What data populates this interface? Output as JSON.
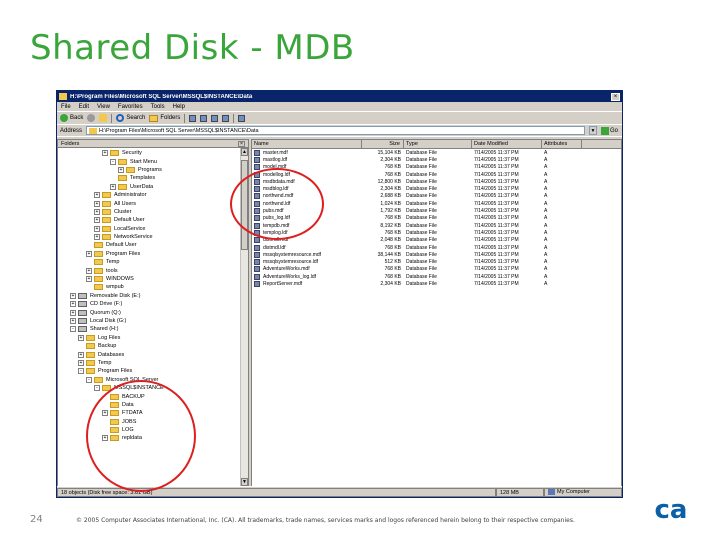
{
  "slide": {
    "title": "Shared Disk - MDB",
    "page_number": "24",
    "copyright": "© 2005 Computer Associates International, Inc. (CA). All trademarks, trade names, services marks and logos referenced herein belong to their respective companies.",
    "logo_text": "ca"
  },
  "window": {
    "title": "H:\\Program Files\\Microsoft SQL Server\\MSSQL$INSTANCE\\Data",
    "close_glyph": "×",
    "menu": [
      "File",
      "Edit",
      "View",
      "Favorites",
      "Tools",
      "Help"
    ],
    "toolbar": {
      "back": "Back",
      "search": "Search",
      "folders": "Folders"
    },
    "address_label": "Address",
    "address_value": "H:\\Program Files\\Microsoft SQL Server\\MSSQL$INSTANCE\\Data",
    "go_label": "Go",
    "dropdown_glyph": "▼"
  },
  "tree": {
    "header": "Folders",
    "close_glyph": "×",
    "nodes": [
      {
        "label": "Security",
        "type": "folder",
        "exp": "+"
      },
      {
        "label": "Start Menu",
        "type": "folder",
        "exp": "-"
      },
      {
        "label": "Programs",
        "type": "folder",
        "exp": "+"
      },
      {
        "label": "Templates",
        "type": "folder",
        "exp": ""
      },
      {
        "label": "UserData",
        "type": "folder",
        "exp": "+"
      },
      {
        "label": "Administrator",
        "type": "folder",
        "exp": "+"
      },
      {
        "label": "All Users",
        "type": "folder",
        "exp": "+"
      },
      {
        "label": "Cluster",
        "type": "folder",
        "exp": "+"
      },
      {
        "label": "Default User",
        "type": "folder",
        "exp": "+"
      },
      {
        "label": "LocalService",
        "type": "folder",
        "exp": "+"
      },
      {
        "label": "NetworkService",
        "type": "folder",
        "exp": "+"
      },
      {
        "label": "Default User",
        "type": "folder",
        "exp": ""
      },
      {
        "label": "Program Files",
        "type": "folder",
        "exp": "+"
      },
      {
        "label": "Temp",
        "type": "folder",
        "exp": ""
      },
      {
        "label": "tools",
        "type": "folder",
        "exp": "+"
      },
      {
        "label": "WINDOWS",
        "type": "folder",
        "exp": "+"
      },
      {
        "label": "wmpub",
        "type": "folder",
        "exp": ""
      },
      {
        "label": "Removable Disk (E:)",
        "type": "drive",
        "exp": "+"
      },
      {
        "label": "CD Drive (F:)",
        "type": "drive",
        "exp": "+"
      },
      {
        "label": "Quorum (Q:)",
        "type": "drive",
        "exp": "+"
      },
      {
        "label": "Local Disk (G:)",
        "type": "drive",
        "exp": "+"
      },
      {
        "label": "Shared (H:)",
        "type": "drive",
        "exp": "-"
      },
      {
        "label": "Log Files",
        "type": "folder",
        "exp": "+"
      },
      {
        "label": "Backup",
        "type": "folder",
        "exp": ""
      },
      {
        "label": "Databases",
        "type": "folder",
        "exp": "+"
      },
      {
        "label": "Temp",
        "type": "folder",
        "exp": "+"
      },
      {
        "label": "Program Files",
        "type": "folder",
        "exp": "-"
      },
      {
        "label": "Microsoft SQL Server",
        "type": "folder",
        "exp": "-"
      },
      {
        "label": "MSSQL$INSTANCE",
        "type": "folder",
        "exp": "-"
      },
      {
        "label": "BACKUP",
        "type": "folder",
        "exp": ""
      },
      {
        "label": "Data",
        "type": "folder",
        "exp": ""
      },
      {
        "label": "FTDATA",
        "type": "folder",
        "exp": "+"
      },
      {
        "label": "JOBS",
        "type": "folder",
        "exp": ""
      },
      {
        "label": "LOG",
        "type": "folder",
        "exp": ""
      },
      {
        "label": "repldata",
        "type": "folder",
        "exp": "+"
      }
    ]
  },
  "list": {
    "headers": [
      "Name",
      "Size",
      "Type",
      "Date Modified",
      "Attributes"
    ],
    "rows": [
      {
        "name": "master.mdf",
        "size": "15,104 KB",
        "type": "Database File",
        "date": "7/14/2005 11:37 PM",
        "attr": "A"
      },
      {
        "name": "mastlog.ldf",
        "size": "2,304 KB",
        "type": "Database File",
        "date": "7/14/2005 11:37 PM",
        "attr": "A"
      },
      {
        "name": "model.mdf",
        "size": "768 KB",
        "type": "Database File",
        "date": "7/14/2005 11:37 PM",
        "attr": "A"
      },
      {
        "name": "modellog.ldf",
        "size": "768 KB",
        "type": "Database File",
        "date": "7/14/2005 11:37 PM",
        "attr": "A"
      },
      {
        "name": "msdbdata.mdf",
        "size": "12,800 KB",
        "type": "Database File",
        "date": "7/14/2005 11:37 PM",
        "attr": "A"
      },
      {
        "name": "msdblog.ldf",
        "size": "2,304 KB",
        "type": "Database File",
        "date": "7/14/2005 11:37 PM",
        "attr": "A"
      },
      {
        "name": "northwnd.mdf",
        "size": "2,688 KB",
        "type": "Database File",
        "date": "7/14/2005 11:37 PM",
        "attr": "A"
      },
      {
        "name": "northwnd.ldf",
        "size": "1,024 KB",
        "type": "Database File",
        "date": "7/14/2005 11:37 PM",
        "attr": "A"
      },
      {
        "name": "pubs.mdf",
        "size": "1,792 KB",
        "type": "Database File",
        "date": "7/14/2005 11:37 PM",
        "attr": "A"
      },
      {
        "name": "pubs_log.ldf",
        "size": "768 KB",
        "type": "Database File",
        "date": "7/14/2005 11:37 PM",
        "attr": "A"
      },
      {
        "name": "tempdb.mdf",
        "size": "8,192 KB",
        "type": "Database File",
        "date": "7/14/2005 11:37 PM",
        "attr": "A"
      },
      {
        "name": "templog.ldf",
        "size": "768 KB",
        "type": "Database File",
        "date": "7/14/2005 11:37 PM",
        "attr": "A"
      },
      {
        "name": "distmdl.mdf",
        "size": "2,048 KB",
        "type": "Database File",
        "date": "7/14/2005 11:37 PM",
        "attr": "A"
      },
      {
        "name": "distmdl.ldf",
        "size": "768 KB",
        "type": "Database File",
        "date": "7/14/2005 11:37 PM",
        "attr": "A"
      },
      {
        "name": "mssqlsystemresource.mdf",
        "size": "38,144 KB",
        "type": "Database File",
        "date": "7/14/2005 11:37 PM",
        "attr": "A"
      },
      {
        "name": "mssqlsystemresource.ldf",
        "size": "512 KB",
        "type": "Database File",
        "date": "7/14/2005 11:37 PM",
        "attr": "A"
      },
      {
        "name": "AdventureWorks.mdf",
        "size": "768 KB",
        "type": "Database File",
        "date": "7/14/2005 11:37 PM",
        "attr": "A"
      },
      {
        "name": "AdventureWorks_log.ldf",
        "size": "768 KB",
        "type": "Database File",
        "date": "7/14/2005 11:37 PM",
        "attr": "A"
      },
      {
        "name": "ReportServer.mdf",
        "size": "2,304 KB",
        "type": "Database File",
        "date": "7/14/2005 11:37 PM",
        "attr": "A"
      }
    ]
  },
  "status": {
    "left": "18 objects (Disk free space: 3.61 GB)",
    "size": "128 MB",
    "computer": "My Computer"
  },
  "colors": {
    "title_green": "#3aa53a",
    "annotation_red": "#dd1f1f",
    "titlebar_blue": "#0a246a",
    "logo_blue": "#0b5fa8"
  },
  "icons": {
    "address": "folder-icon",
    "go": "go-arrow-icon",
    "list_item": "database-file-icon",
    "status": "computer-icon"
  }
}
